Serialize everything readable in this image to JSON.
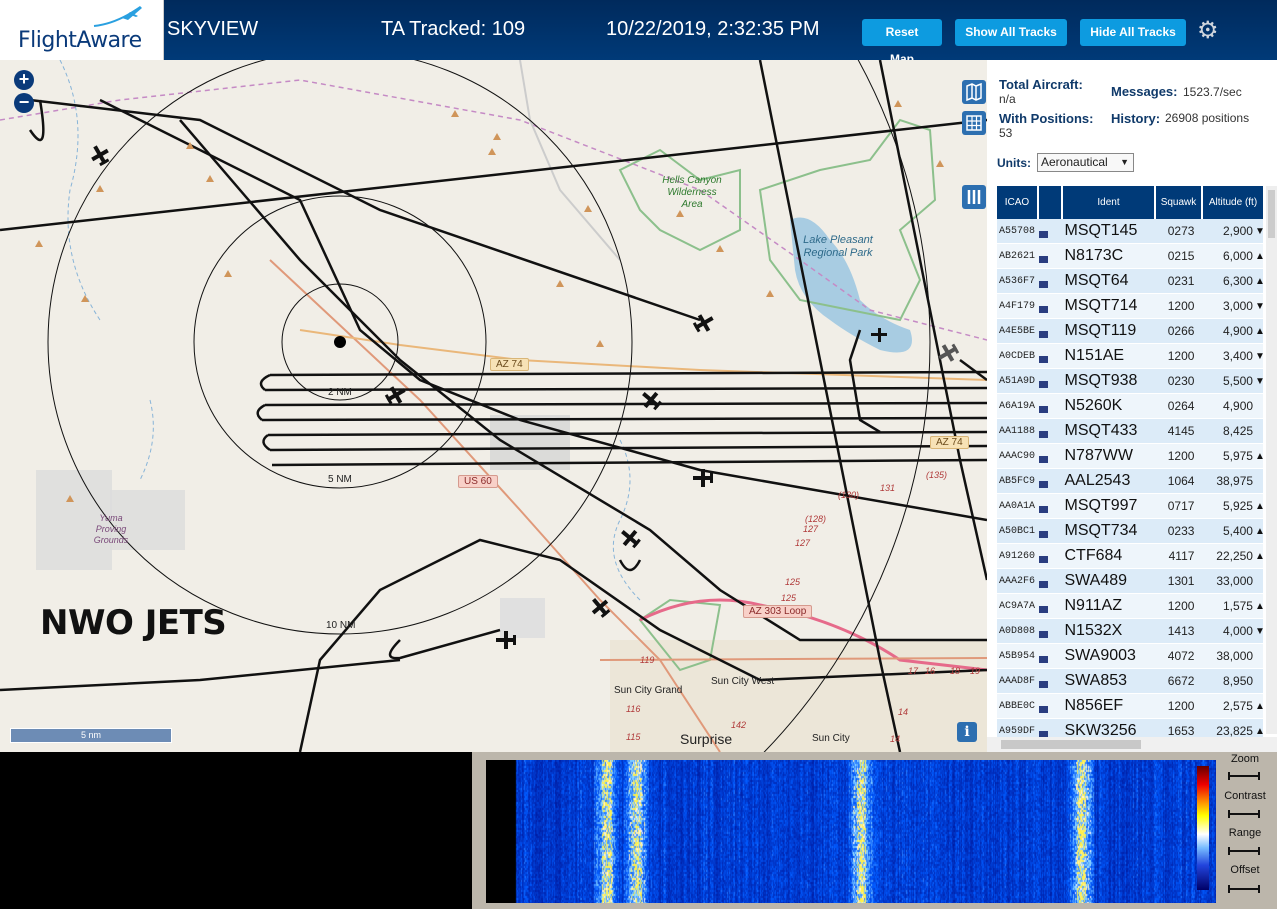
{
  "header": {
    "logo_text": "FlightAware",
    "site_name": "SKYVIEW",
    "tracked": "TA Tracked: 109",
    "datetime": "10/22/2019, 2:32:35 PM",
    "buttons": {
      "reset": "Reset Map",
      "show": "Show All Tracks",
      "hide": "Hide All Tracks"
    }
  },
  "map": {
    "overlay_text": "NWO JETS",
    "scale": "5 nm",
    "ranges": [
      "2 NM",
      "5 NM",
      "10 NM"
    ],
    "places": [
      "Hells Canyon Wilderness Area",
      "Lake Pleasant Regional Park",
      "Yuma Proving Grounds",
      "Sun City Grand",
      "Sun City West",
      "Surprise",
      "Sun City"
    ],
    "roads": [
      "AZ 74",
      "US 60",
      "AZ 303 Loop",
      "AZ 74"
    ],
    "numbers": [
      "131",
      "(135)",
      "(130)",
      "(128)",
      "127",
      "127",
      "125",
      "125",
      "119",
      "116",
      "115",
      "142",
      "17",
      "16",
      "18",
      "19",
      "14",
      "14"
    ]
  },
  "stats": {
    "total_label": "Total Aircraft:",
    "total_value": "n/a",
    "messages_label": "Messages:",
    "messages_value": "1523.7/sec",
    "positions_label": "With Positions:",
    "positions_value": "53",
    "history_label": "History:",
    "history_value": "26908 positions",
    "units_label": "Units:",
    "units_value": "Aeronautical"
  },
  "table": {
    "headers": [
      "ICAO",
      "Ident",
      "Squawk",
      "Altitude (ft)"
    ],
    "rows": [
      {
        "icao": "A55708",
        "ident": "MSQT145",
        "squawk": "0273",
        "alt": "2,900",
        "trend": "▼"
      },
      {
        "icao": "AB2621",
        "ident": "N8173C",
        "squawk": "0215",
        "alt": "6,000",
        "trend": "▲"
      },
      {
        "icao": "A536F7",
        "ident": "MSQT64",
        "squawk": "0231",
        "alt": "6,300",
        "trend": "▲"
      },
      {
        "icao": "A4F179",
        "ident": "MSQT714",
        "squawk": "1200",
        "alt": "3,000",
        "trend": "▼"
      },
      {
        "icao": "A4E5BE",
        "ident": "MSQT119",
        "squawk": "0266",
        "alt": "4,900",
        "trend": "▲"
      },
      {
        "icao": "A0CDEB",
        "ident": "N151AE",
        "squawk": "1200",
        "alt": "3,400",
        "trend": "▼"
      },
      {
        "icao": "A51A9D",
        "ident": "MSQT938",
        "squawk": "0230",
        "alt": "5,500",
        "trend": "▼"
      },
      {
        "icao": "A6A19A",
        "ident": "N5260K",
        "squawk": "0264",
        "alt": "4,900",
        "trend": ""
      },
      {
        "icao": "AA1188",
        "ident": "MSQT433",
        "squawk": "4145",
        "alt": "8,425",
        "trend": ""
      },
      {
        "icao": "AAAC90",
        "ident": "N787WW",
        "squawk": "1200",
        "alt": "5,975",
        "trend": "▲"
      },
      {
        "icao": "AB5FC9",
        "ident": "AAL2543",
        "squawk": "1064",
        "alt": "38,975",
        "trend": ""
      },
      {
        "icao": "AA0A1A",
        "ident": "MSQT997",
        "squawk": "0717",
        "alt": "5,925",
        "trend": "▲"
      },
      {
        "icao": "A50BC1",
        "ident": "MSQT734",
        "squawk": "0233",
        "alt": "5,400",
        "trend": "▲"
      },
      {
        "icao": "A91260",
        "ident": "CTF684",
        "squawk": "4117",
        "alt": "22,250",
        "trend": "▲"
      },
      {
        "icao": "AAA2F6",
        "ident": "SWA489",
        "squawk": "1301",
        "alt": "33,000",
        "trend": ""
      },
      {
        "icao": "AC9A7A",
        "ident": "N911AZ",
        "squawk": "1200",
        "alt": "1,575",
        "trend": "▲"
      },
      {
        "icao": "A0D808",
        "ident": "N1532X",
        "squawk": "1413",
        "alt": "4,000",
        "trend": "▼"
      },
      {
        "icao": "A5B954",
        "ident": "SWA9003",
        "squawk": "4072",
        "alt": "38,000",
        "trend": ""
      },
      {
        "icao": "AAAD8F",
        "ident": "SWA853",
        "squawk": "6672",
        "alt": "8,950",
        "trend": ""
      },
      {
        "icao": "ABBE0C",
        "ident": "N856EF",
        "squawk": "1200",
        "alt": "2,575",
        "trend": "▲"
      },
      {
        "icao": "A959DF",
        "ident": "SKW3256",
        "squawk": "1653",
        "alt": "23,825",
        "trend": "▲"
      }
    ]
  },
  "spectrum": {
    "controls": [
      "Zoom",
      "Contrast",
      "Range",
      "Offset"
    ]
  }
}
